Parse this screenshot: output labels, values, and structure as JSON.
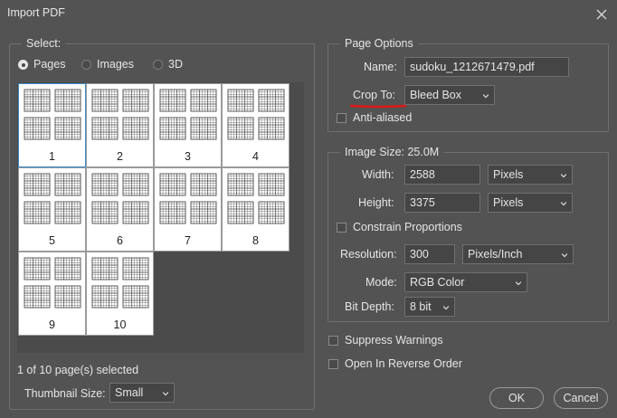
{
  "window": {
    "title": "Import PDF"
  },
  "select_panel": {
    "legend": "Select:",
    "radios": [
      {
        "label": "Pages",
        "checked": true
      },
      {
        "label": "Images",
        "checked": false
      },
      {
        "label": "3D",
        "checked": false
      }
    ],
    "thumbnails": [
      "1",
      "2",
      "3",
      "4",
      "5",
      "6",
      "7",
      "8",
      "9",
      "10"
    ],
    "selected_thumbnail": "1",
    "selection_status": "1 of 10 page(s) selected",
    "thumbnail_size_label": "Thumbnail Size:",
    "thumbnail_size_value": "Small"
  },
  "page_options": {
    "legend": "Page Options",
    "name_label": "Name:",
    "name_value": "sudoku_1212671479.pdf",
    "crop_to_label": "Crop To:",
    "crop_to_value": "Bleed Box",
    "anti_aliased_label": "Anti-aliased",
    "anti_aliased_checked": false
  },
  "image_size": {
    "legend": "Image Size: 25.0M",
    "width_label": "Width:",
    "width_value": "2588",
    "width_unit": "Pixels",
    "height_label": "Height:",
    "height_value": "3375",
    "height_unit": "Pixels",
    "constrain_label": "Constrain Proportions",
    "constrain_checked": false,
    "resolution_label": "Resolution:",
    "resolution_value": "300",
    "resolution_unit": "Pixels/Inch",
    "mode_label": "Mode:",
    "mode_value": "RGB Color",
    "bit_depth_label": "Bit Depth:",
    "bit_depth_value": "8 bit"
  },
  "options": {
    "suppress_warnings_label": "Suppress Warnings",
    "suppress_warnings_checked": false,
    "reverse_order_label": "Open In Reverse Order",
    "reverse_order_checked": false
  },
  "buttons": {
    "ok": "OK",
    "cancel": "Cancel"
  },
  "colors": {
    "dialog_bg": "#535353",
    "selection_border": "#3c8ad0",
    "annotation_red": "#e01818"
  }
}
